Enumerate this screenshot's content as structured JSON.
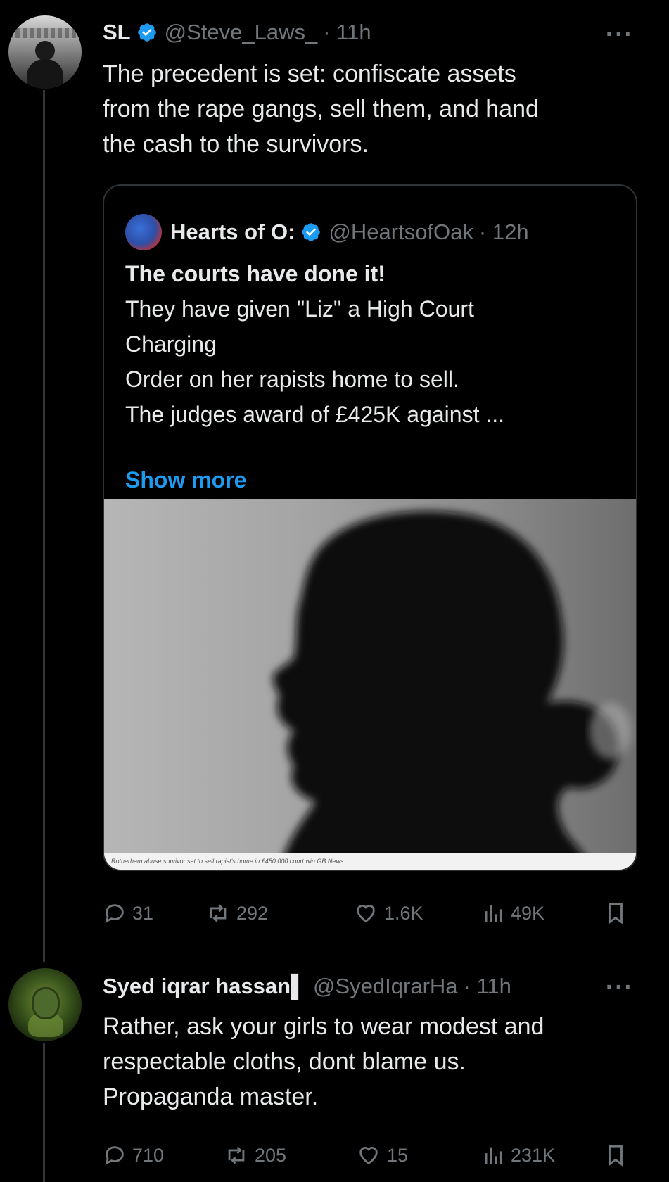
{
  "tweet1": {
    "name": "SL",
    "handle": "@Steve_Laws_",
    "time": "· 11h",
    "more": "···",
    "text_line1": "The precedent is set: confiscate assets",
    "text_line2": "from the rape gangs, sell them, and hand",
    "text_line3": "the cash to the survivors.",
    "quote": {
      "name": "Hearts of O:",
      "handle": "@HeartsofOak",
      "time": "· 12h",
      "bold_line": "The courts have done it!",
      "line1": "They have given \"Liz\" a High Court",
      "line2": "Charging",
      "line3": "Order on her rapists home to sell.",
      "line4": "The judges award of £425K against ...",
      "show_more": "Show more",
      "image_caption": "Rotherham abuse survivor set to sell rapist's home in £450,000 court win GB News"
    },
    "actions": {
      "replies": "31",
      "reposts": "292",
      "likes": "1.6K",
      "views": "49K"
    }
  },
  "tweet2": {
    "name": "Syed iqrar hassan▌",
    "handle": "@SyedIqrarHa",
    "time": "· 11h",
    "more": "···",
    "text_line1": "Rather, ask your girls to wear modest and",
    "text_line2": "respectable cloths, dont blame us.",
    "text_line3": "Propaganda master.",
    "actions": {
      "replies": "710",
      "reposts": "205",
      "likes": "15",
      "views": "231K"
    }
  },
  "colors": {
    "background": "#000000",
    "text": "#e7e9ea",
    "muted": "#71767b",
    "link": "#1d9bf0",
    "verified": "#1d9bf0"
  }
}
